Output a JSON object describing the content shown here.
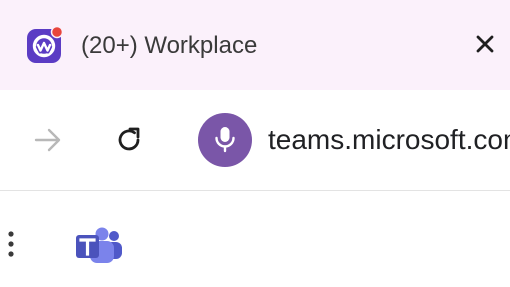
{
  "tab": {
    "title": "(20+) Workplace",
    "favicon": "workplace-icon",
    "notification_dot_color": "#e8453c",
    "favicon_color": "#5b3cc4"
  },
  "toolbar": {
    "forward_icon": "arrow-right-icon",
    "reload_icon": "reload-icon",
    "mic_icon": "microphone-icon",
    "mic_color": "#7a56a8",
    "url": "teams.microsoft.com"
  },
  "bookmarks": {
    "menu_icon": "more-vertical-icon",
    "app_icon": "microsoft-teams-icon",
    "teams_color": "#5059c9"
  }
}
